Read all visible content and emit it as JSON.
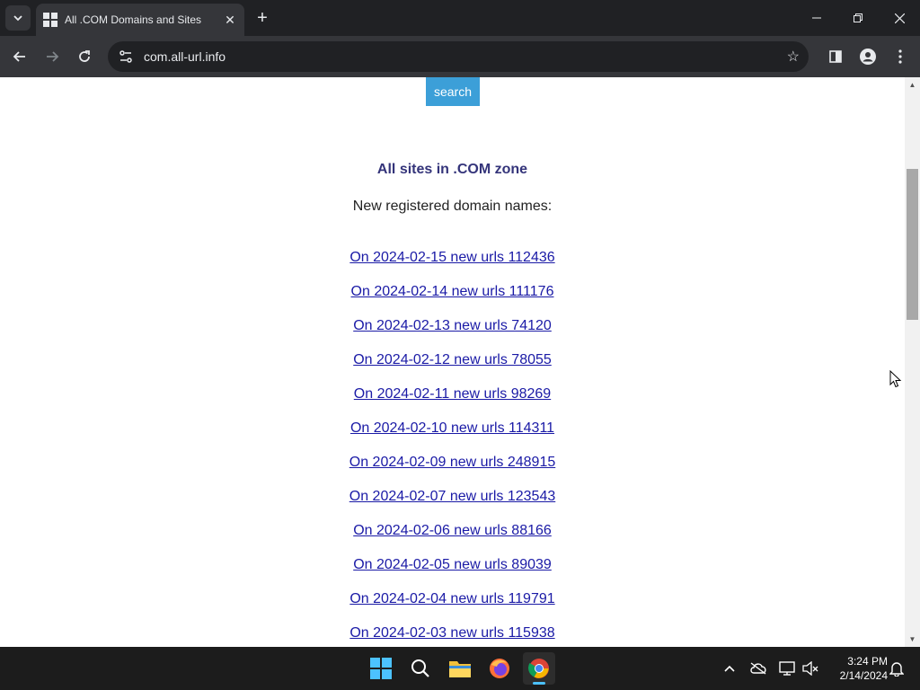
{
  "browser": {
    "tab_title": "All .COM Domains and Sites",
    "url": "com.all-url.info"
  },
  "page": {
    "search_button": "search",
    "zone_title": "All sites in .COM zone",
    "subtitle": "New registered domain names:",
    "links": [
      "On 2024-02-15 new urls 112436",
      "On 2024-02-14 new urls 111176",
      "On 2024-02-13 new urls 74120",
      "On 2024-02-12 new urls 78055",
      "On 2024-02-11 new urls 98269",
      "On 2024-02-10 new urls 114311",
      "On 2024-02-09 new urls 248915",
      "On 2024-02-07 new urls 123543",
      "On 2024-02-06 new urls 88166",
      "On 2024-02-05 new urls 89039",
      "On 2024-02-04 new urls 119791",
      "On 2024-02-03 new urls 115938"
    ],
    "link_color": "#1a1aa6",
    "title_color": "#34347a",
    "button_color": "#3c9fd8"
  },
  "taskbar": {
    "time": "3:24 PM",
    "date": "2/14/2024",
    "apps": [
      "windows-start",
      "search",
      "file-explorer",
      "firefox",
      "chrome"
    ]
  }
}
